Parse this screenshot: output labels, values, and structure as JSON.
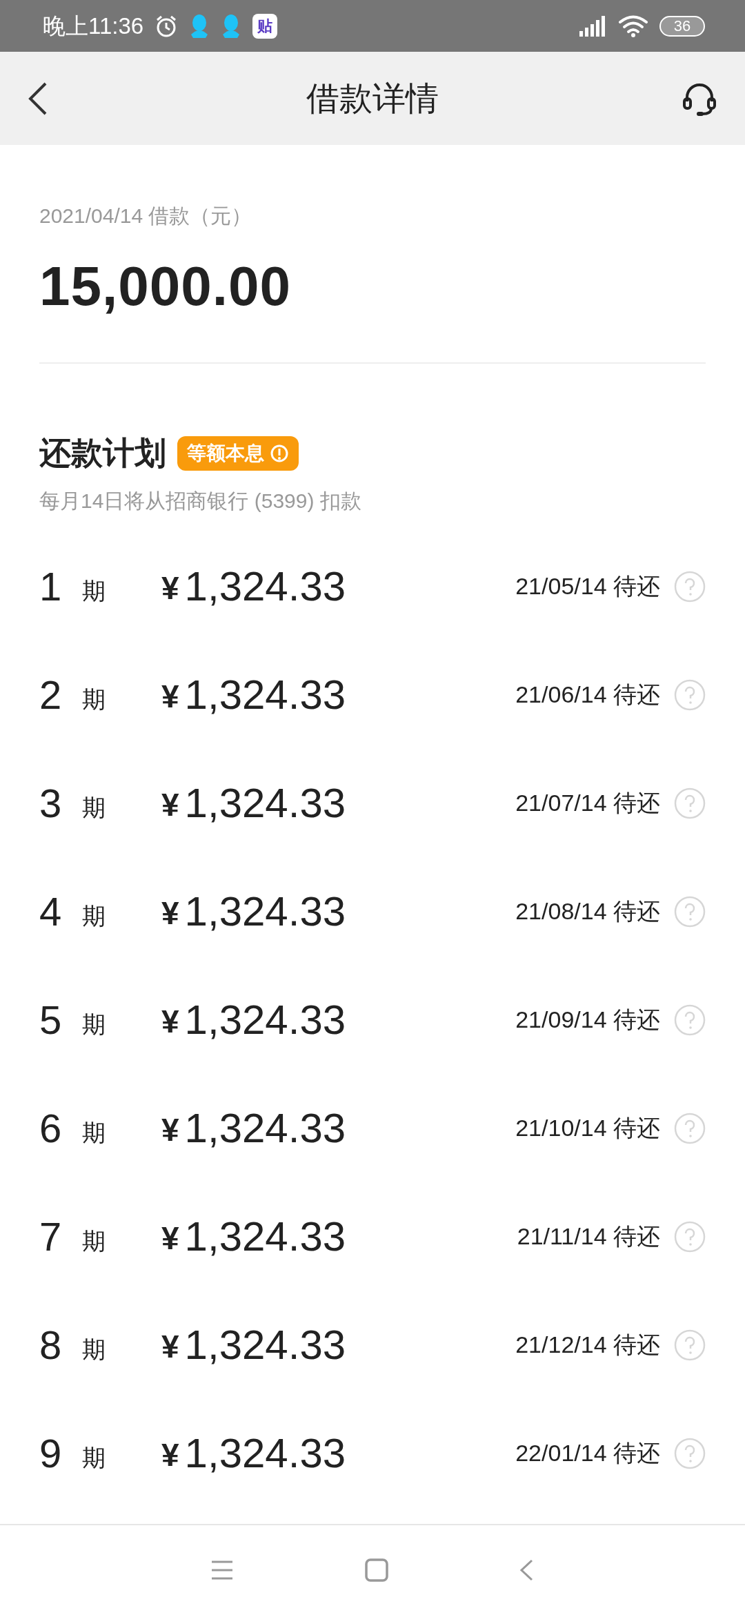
{
  "status_bar": {
    "time": "晚上11:36",
    "app_badge": "贴",
    "battery": "36"
  },
  "header": {
    "title": "借款详情"
  },
  "loan": {
    "caption": "2021/04/14 借款（元）",
    "amount": "15,000.00"
  },
  "plan": {
    "title": "还款计划",
    "tag": "等额本息",
    "note": "每月14日将从招商银行 (5399) 扣款",
    "installments": [
      {
        "number": "1",
        "unit": "期",
        "currency": "¥",
        "amount": "1,324.33",
        "due": "21/05/14 待还"
      },
      {
        "number": "2",
        "unit": "期",
        "currency": "¥",
        "amount": "1,324.33",
        "due": "21/06/14 待还"
      },
      {
        "number": "3",
        "unit": "期",
        "currency": "¥",
        "amount": "1,324.33",
        "due": "21/07/14 待还"
      },
      {
        "number": "4",
        "unit": "期",
        "currency": "¥",
        "amount": "1,324.33",
        "due": "21/08/14 待还"
      },
      {
        "number": "5",
        "unit": "期",
        "currency": "¥",
        "amount": "1,324.33",
        "due": "21/09/14 待还"
      },
      {
        "number": "6",
        "unit": "期",
        "currency": "¥",
        "amount": "1,324.33",
        "due": "21/10/14 待还"
      },
      {
        "number": "7",
        "unit": "期",
        "currency": "¥",
        "amount": "1,324.33",
        "due": "21/11/14 待还"
      },
      {
        "number": "8",
        "unit": "期",
        "currency": "¥",
        "amount": "1,324.33",
        "due": "21/12/14 待还"
      },
      {
        "number": "9",
        "unit": "期",
        "currency": "¥",
        "amount": "1,324.33",
        "due": "22/01/14 待还"
      }
    ]
  }
}
